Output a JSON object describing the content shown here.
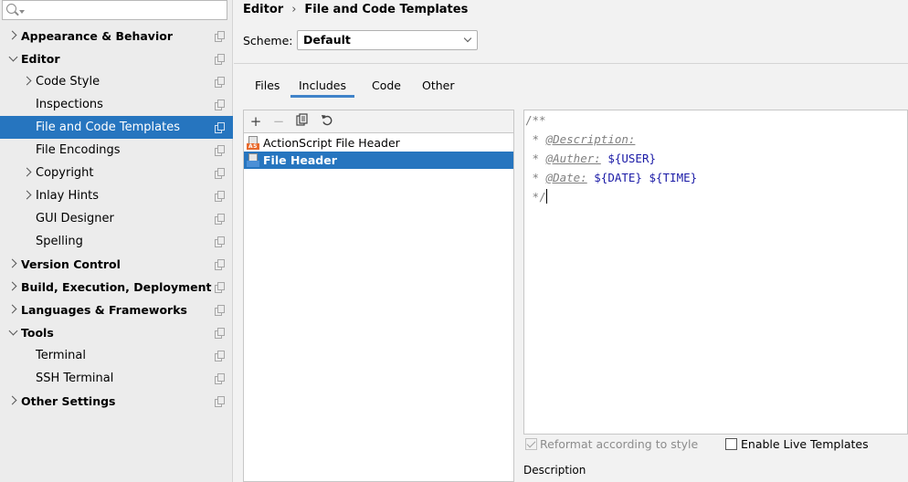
{
  "search": {
    "placeholder": "",
    "value": ""
  },
  "sidebar": {
    "items": [
      {
        "label": "Appearance & Behavior",
        "level": 0,
        "expand": "collapsed",
        "bold": true
      },
      {
        "label": "Editor",
        "level": 0,
        "expand": "expanded",
        "bold": true
      },
      {
        "label": "Code Style",
        "level": 1,
        "expand": "collapsed",
        "bold": false
      },
      {
        "label": "Inspections",
        "level": 1,
        "expand": "none",
        "bold": false
      },
      {
        "label": "File and Code Templates",
        "level": 1,
        "expand": "none",
        "bold": false,
        "selected": true
      },
      {
        "label": "File Encodings",
        "level": 1,
        "expand": "none",
        "bold": false
      },
      {
        "label": "Copyright",
        "level": 1,
        "expand": "collapsed",
        "bold": false
      },
      {
        "label": "Inlay Hints",
        "level": 1,
        "expand": "collapsed",
        "bold": false
      },
      {
        "label": "GUI Designer",
        "level": 1,
        "expand": "none",
        "bold": false
      },
      {
        "label": "Spelling",
        "level": 1,
        "expand": "none",
        "bold": false
      },
      {
        "label": "Version Control",
        "level": 0,
        "expand": "collapsed",
        "bold": true
      },
      {
        "label": "Build, Execution, Deployment",
        "level": 0,
        "expand": "collapsed",
        "bold": true
      },
      {
        "label": "Languages & Frameworks",
        "level": 0,
        "expand": "collapsed",
        "bold": true
      },
      {
        "label": "Tools",
        "level": 0,
        "expand": "expanded",
        "bold": true
      },
      {
        "label": "Terminal",
        "level": 1,
        "expand": "none",
        "bold": false
      },
      {
        "label": "SSH Terminal",
        "level": 1,
        "expand": "none",
        "bold": false
      },
      {
        "label": "Other Settings",
        "level": 0,
        "expand": "collapsed",
        "bold": true
      }
    ]
  },
  "breadcrumb": {
    "parent": "Editor",
    "separator": "›",
    "current": "File and Code Templates"
  },
  "scheme": {
    "label": "Scheme:",
    "value": "Default"
  },
  "tabs": [
    {
      "label": "Files",
      "active": false
    },
    {
      "label": "Includes",
      "active": true
    },
    {
      "label": "Code",
      "active": false
    },
    {
      "label": "Other",
      "active": false
    }
  ],
  "toolbar": {
    "add": "+",
    "remove": "−",
    "copy": "copy",
    "reset": "reset"
  },
  "templates": [
    {
      "name": "ActionScript File Header",
      "badge": "AS",
      "icon": "actionscript-file-icon",
      "selected": false
    },
    {
      "name": "File Header",
      "badge": "",
      "icon": "java-file-icon",
      "selected": true
    }
  ],
  "editor": {
    "lines": [
      {
        "parts": [
          {
            "t": "/**",
            "k": "plain"
          }
        ]
      },
      {
        "parts": [
          {
            "t": " * ",
            "k": "plain"
          },
          {
            "t": "@Description:",
            "k": "tag"
          }
        ]
      },
      {
        "parts": [
          {
            "t": " * ",
            "k": "plain"
          },
          {
            "t": "@Auther:",
            "k": "tag"
          },
          {
            "t": " ",
            "k": "plain"
          },
          {
            "t": "${USER}",
            "k": "var"
          }
        ]
      },
      {
        "parts": [
          {
            "t": " * ",
            "k": "plain"
          },
          {
            "t": "@Date:",
            "k": "tag"
          },
          {
            "t": " ",
            "k": "plain"
          },
          {
            "t": "${DATE}",
            "k": "var"
          },
          {
            "t": " ",
            "k": "plain"
          },
          {
            "t": "${TIME}",
            "k": "var"
          }
        ]
      },
      {
        "parts": [
          {
            "t": " */",
            "k": "plain"
          }
        ],
        "caret": true
      }
    ]
  },
  "options": {
    "reformat": {
      "label": "Reformat according to style",
      "checked": true,
      "enabled": false
    },
    "live_templates": {
      "label": "Enable Live Templates",
      "checked": false,
      "enabled": true
    }
  },
  "description": {
    "label": "Description"
  },
  "colors": {
    "selection": "#2675bf",
    "variable": "#1a1aa6",
    "comment": "#808080",
    "tab_underline": "#4083c9",
    "as_badge": "#e8692c",
    "java_badge": "#4b8fd6"
  }
}
